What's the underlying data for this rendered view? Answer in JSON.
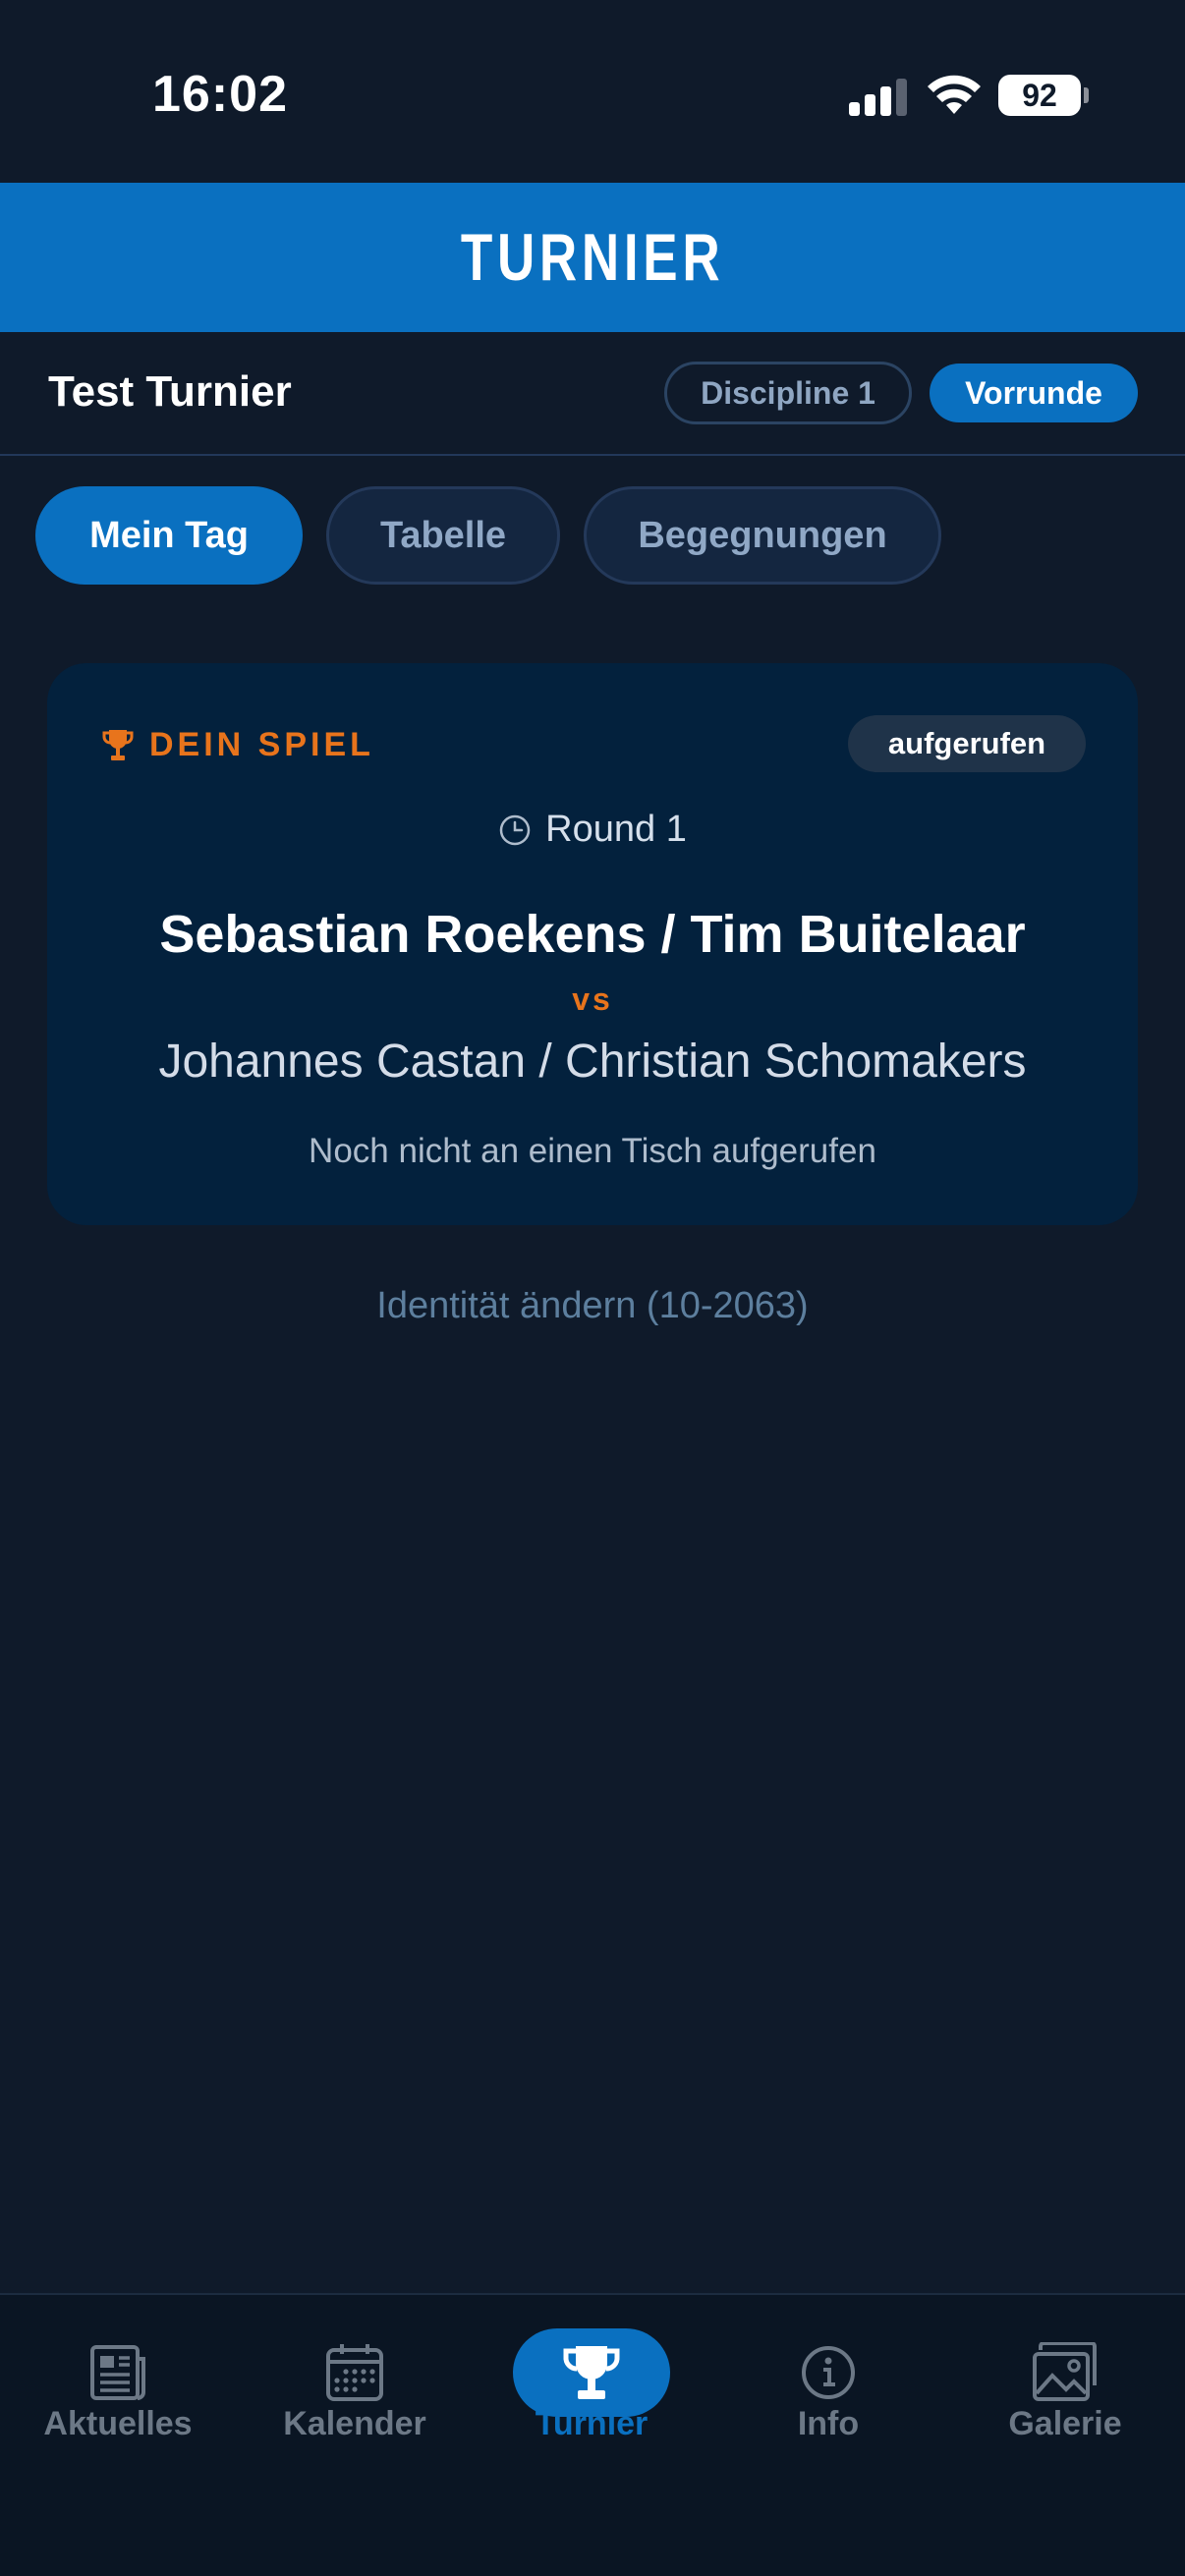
{
  "status_bar": {
    "time": "16:02",
    "battery": "92"
  },
  "header": {
    "title": "TURNIER"
  },
  "subheader": {
    "tournament_name": "Test Turnier",
    "discipline_chip": "Discipline 1",
    "phase_chip": "Vorrunde"
  },
  "tabs": [
    {
      "label": "Mein Tag",
      "active": true
    },
    {
      "label": "Tabelle",
      "active": false
    },
    {
      "label": "Begegnungen",
      "active": false
    }
  ],
  "match_card": {
    "label": "DEIN SPIEL",
    "status": "aufgerufen",
    "round": "Round 1",
    "team1": "Sebastian Roekens / Tim Buitelaar",
    "vs": "vs",
    "team2": "Johannes Castan / Christian Schomakers",
    "table_note": "Noch nicht an einen Tisch aufgerufen"
  },
  "identity_link": "Identität ändern (10-2063)",
  "bottom_nav": [
    {
      "label": "Aktuelles",
      "icon": "newspaper-icon",
      "active": false
    },
    {
      "label": "Kalender",
      "icon": "calendar-icon",
      "active": false
    },
    {
      "label": "Turnier",
      "icon": "trophy-icon",
      "active": true
    },
    {
      "label": "Info",
      "icon": "info-icon",
      "active": false
    },
    {
      "label": "Galerie",
      "icon": "gallery-icon",
      "active": false
    }
  ],
  "colors": {
    "accent": "#0a70c0",
    "orange": "#e8741c",
    "background": "#0f1a2a",
    "card": "#03213d"
  }
}
